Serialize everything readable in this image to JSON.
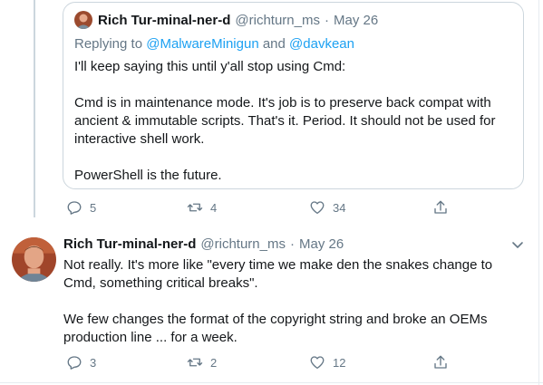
{
  "quoted_tweet": {
    "author_name": "Rich Tur-minal-ner-d",
    "handle": "@richturn_ms",
    "separator": "·",
    "date": "May 26",
    "replying_prefix": "Replying to",
    "replying_user1": "@MalwareMinigun",
    "replying_and": "and",
    "replying_user2": "@davkean",
    "paragraphs": [
      "I'll keep saying this until y'all stop using Cmd:",
      "Cmd is in maintenance mode. It's job is to preserve back compat with ancient & immutable scripts. That's it. Period. It should not be used for interactive shell work.",
      "PowerShell is the future."
    ],
    "reply_count": "5",
    "retweet_count": "4",
    "like_count": "34"
  },
  "reply_tweet": {
    "author_name": "Rich Tur-minal-ner-d",
    "handle": "@richturn_ms",
    "separator": "·",
    "date": "May 26",
    "paragraphs": [
      "Not really. It's more like \"every time we make den the snakes change to Cmd, something critical breaks\".",
      "We few changes the format of the copyright string and broke an OEMs production line ... for a week."
    ],
    "reply_count": "3",
    "retweet_count": "2",
    "like_count": "12"
  },
  "colors": {
    "text": "#14171a",
    "secondary": "#657786",
    "link": "#1da1f2",
    "border": "#ccd6dd"
  },
  "icons": [
    "reply-icon",
    "retweet-icon",
    "like-icon",
    "share-icon",
    "chevron-down-icon"
  ]
}
